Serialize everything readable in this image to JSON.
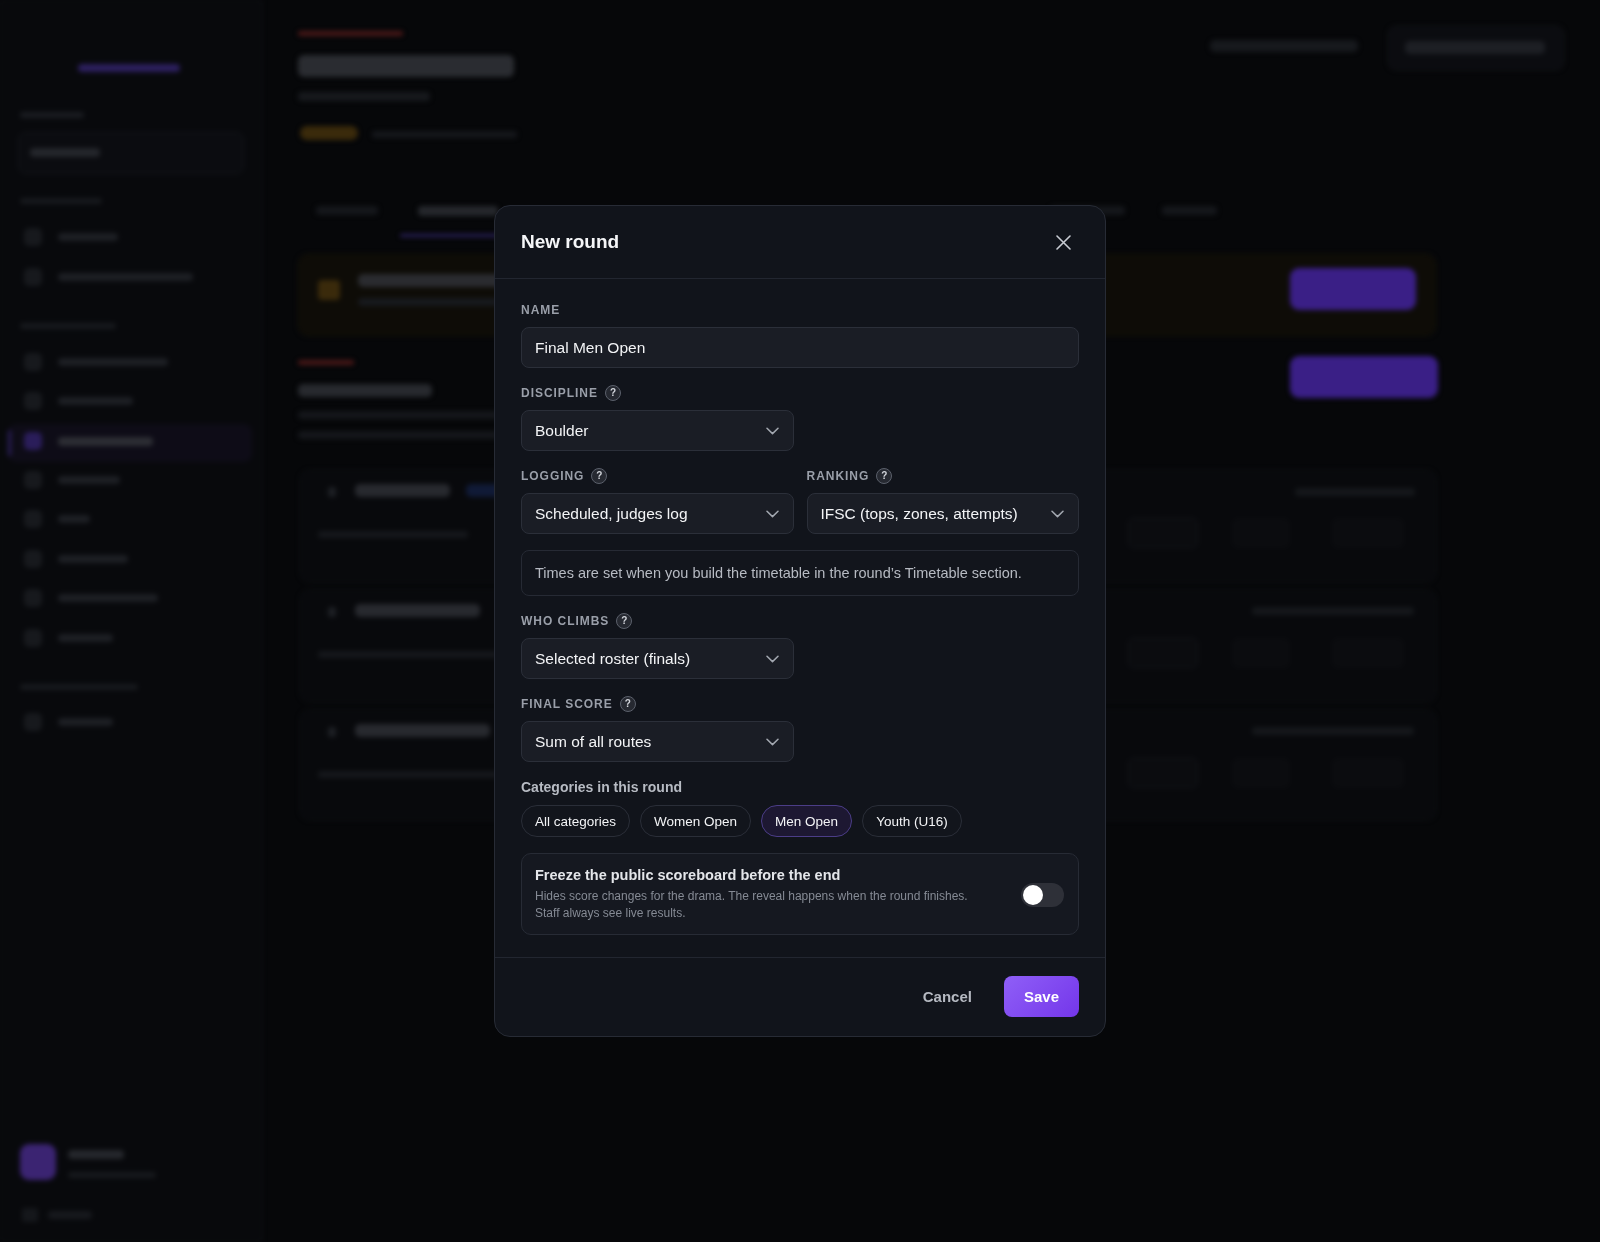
{
  "dialog": {
    "title": "New round"
  },
  "rows": [
    {
      "fields": [
        {
          "kind": "text",
          "label": "NAME",
          "value": "Final Men Open"
        }
      ]
    },
    {
      "fields": [
        {
          "kind": "select",
          "label": "DISCIPLINE",
          "help_icon": "?",
          "value": "Boulder"
        }
      ]
    },
    {
      "fields": [
        {
          "kind": "select",
          "label": "LOGGING",
          "help_icon": "?",
          "value": "Scheduled, judges log"
        },
        {
          "kind": "select",
          "label": "RANKING",
          "help_icon": "?",
          "value": "IFSC (tops, zones, attempts)"
        }
      ]
    },
    {
      "fields": [
        {
          "kind": "note",
          "text": "Times are set when you build the timetable in the round’s Timetable section."
        }
      ]
    },
    {
      "fields": [
        {
          "kind": "select",
          "label": "WHO CLIMBS",
          "help_icon": "?",
          "value": "Selected roster (finals)"
        }
      ]
    },
    {
      "fields": [
        {
          "kind": "select",
          "label": "FINAL SCORE",
          "help_icon": "?",
          "value": "Sum of all routes"
        }
      ]
    }
  ],
  "categories": {
    "label": "Categories in this round",
    "chips": [
      {
        "label": "All categories",
        "selected": false
      },
      {
        "label": "Women Open",
        "selected": false
      },
      {
        "label": "Men Open",
        "selected": true
      },
      {
        "label": "Youth (U16)",
        "selected": false
      }
    ]
  },
  "freeze": {
    "title": "Freeze the public scoreboard before the end",
    "description": "Hides score changes for the drama. The reveal happens when the round finishes. Staff always see live results.",
    "on": false
  },
  "buttons": [
    {
      "kind": "secondary",
      "label": "Cancel"
    },
    {
      "kind": "primary",
      "label": "Save"
    }
  ]
}
